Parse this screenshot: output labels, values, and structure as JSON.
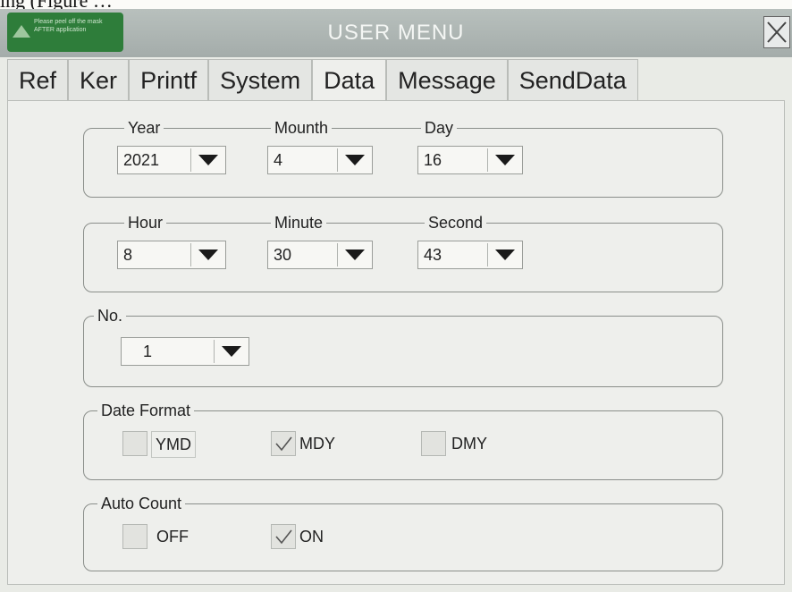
{
  "page_top_text": "ing (Figure …",
  "sticker": {
    "line1": "Please peel off the mask",
    "line2": "AFTER application"
  },
  "window": {
    "title": "USER MENU"
  },
  "tabs": [
    "Ref",
    "Ker",
    "Printf",
    "System",
    "Data",
    "Message",
    "SendData"
  ],
  "active_tab": "Data",
  "date": {
    "year_label": "Year",
    "year_value": "2021",
    "month_label": "Mounth",
    "month_value": "4",
    "day_label": "Day",
    "day_value": "16"
  },
  "time": {
    "hour_label": "Hour",
    "hour_value": "8",
    "minute_label": "Minute",
    "minute_value": "30",
    "second_label": "Second",
    "second_value": "43"
  },
  "number": {
    "label": "No.",
    "value": "1"
  },
  "date_format": {
    "label": "Date Format",
    "options": [
      {
        "label": "YMD",
        "checked": false
      },
      {
        "label": "MDY",
        "checked": true
      },
      {
        "label": "DMY",
        "checked": false
      }
    ]
  },
  "auto_count": {
    "label": "Auto Count",
    "options": [
      {
        "label": "OFF",
        "checked": false
      },
      {
        "label": "ON",
        "checked": true
      }
    ]
  },
  "colors": {
    "sticker": "#2e7d3a",
    "titlebar": "#b0b8b6",
    "panel": "#eeefec"
  },
  "icons": {
    "close": "close-icon",
    "dropdown": "triangle-down-icon",
    "check": "checkmark-icon"
  }
}
